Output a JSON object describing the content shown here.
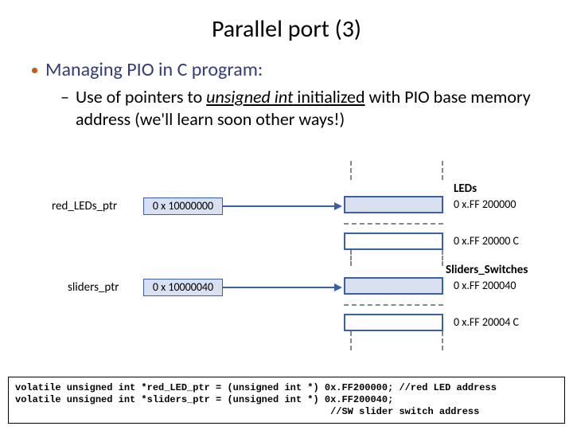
{
  "title": "Parallel port (3)",
  "bullet": "Managing PIO in C program:",
  "sub_prefix": "Use of pointers to ",
  "sub_italic": "unsigned int",
  "sub_underlined": " initialized",
  "sub_rest": " with PIO base memory address (we'll learn soon other ways!)",
  "ptr1_label": "red_LEDs_ptr",
  "ptr1_value": "0 x 10000000",
  "ptr2_label": "sliders_ptr",
  "ptr2_value": "0 x 10000040",
  "header_leds": "LEDs",
  "addr_led_base": "0 x.FF 200000",
  "addr_led_end": "0 x.FF 20000 C",
  "header_sliders": "Sliders_Switches",
  "addr_slider_base": "0 x.FF 200040",
  "addr_slider_end": "0 x.FF 20004 C",
  "code_line1": "volatile unsigned int *red_LED_ptr = (unsigned int *) 0x.FF200000; //red LED address",
  "code_line2": "volatile unsigned int *sliders_ptr = (unsigned int *) 0x.FF200040;",
  "code_line3": "                                                       //SW slider switch address"
}
